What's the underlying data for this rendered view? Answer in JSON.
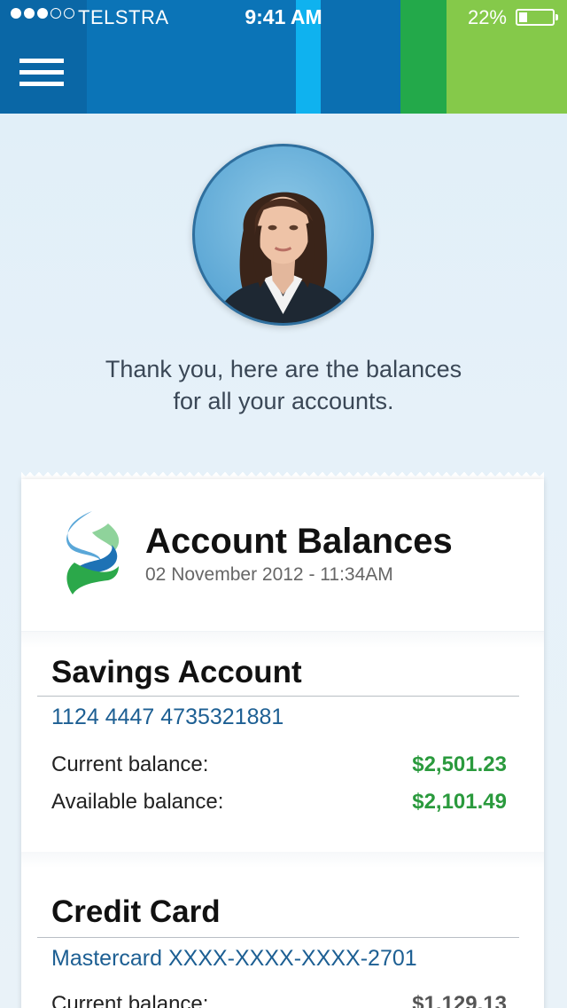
{
  "status_bar": {
    "carrier": "TELSTRA",
    "time": "9:41 AM",
    "battery": "22%",
    "battery_level": 0.22,
    "signal_bars": 3,
    "signal_total": 5
  },
  "header": {
    "menu_icon": "hamburger-menu-icon"
  },
  "assistant": {
    "avatar": "assistant-avatar",
    "message_line1": "Thank you, here are the balances",
    "message_line2": "for all your accounts."
  },
  "card": {
    "title": "Account Balances",
    "subtitle": "02 November 2012 - 11:34AM",
    "logo": "bank-logo-icon",
    "accounts": [
      {
        "name": "Savings Account",
        "number": "1124 4447  4735321881",
        "rows": [
          {
            "label": "Current balance:",
            "value": "$2,501.23"
          },
          {
            "label": "Available balance:",
            "value": "$2,101.49"
          }
        ]
      },
      {
        "name": "Credit Card",
        "number": "Mastercard XXXX-XXXX-XXXX-2701",
        "rows": [
          {
            "label": "Current balance:",
            "value": "$1,129.13"
          }
        ]
      }
    ]
  },
  "colors": {
    "header_blue": "#0a68a8",
    "accent_cyan": "#0fb2ef",
    "accent_green": "#23a94a",
    "accent_lime": "#85c94a",
    "balance_green": "#2a9a3d",
    "account_number_blue": "#1d5f93"
  }
}
